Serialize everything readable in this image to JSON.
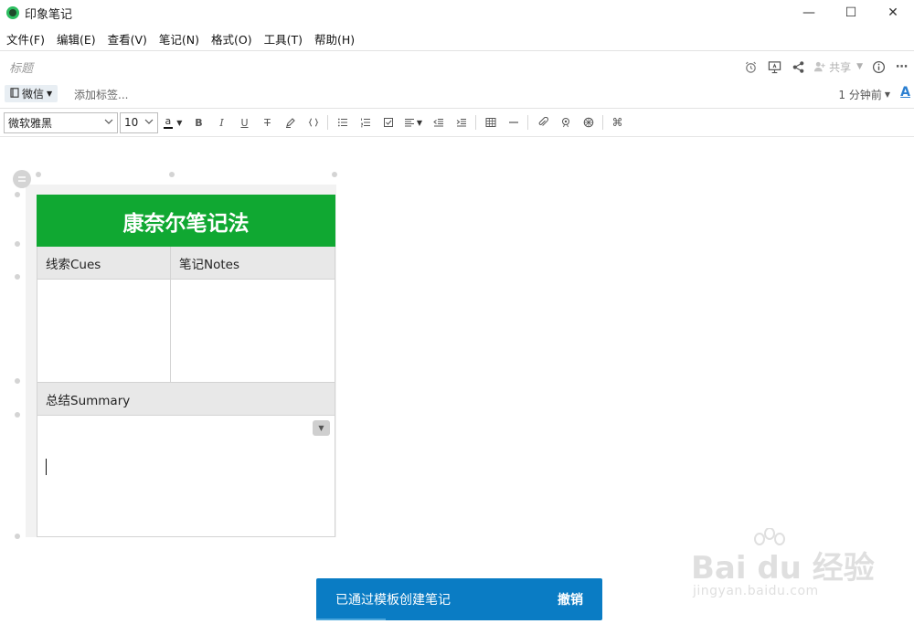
{
  "window": {
    "title": "印象笔记",
    "controls": {
      "minimize": "—",
      "maximize": "☐",
      "close": "✕"
    }
  },
  "menu": [
    "文件(F)",
    "编辑(E)",
    "查看(V)",
    "笔记(N)",
    "格式(O)",
    "工具(T)",
    "帮助(H)"
  ],
  "note": {
    "title_placeholder": "标题",
    "share_label": "共享",
    "notebook": "微信",
    "tag_placeholder": "添加标签...",
    "edit_time": "1 分钟前",
    "font_style_letter": "A"
  },
  "toolbar": {
    "font_family": "微软雅黑",
    "font_size": "10",
    "color_letter": "a",
    "bold": "B",
    "italic": "I",
    "underline": "U",
    "strike": "T"
  },
  "template": {
    "title": "康奈尔笔记法",
    "cues_label": "线索Cues",
    "notes_label": "笔记Notes",
    "summary_label": "总结Summary"
  },
  "toast": {
    "message": "已通过模板创建笔记",
    "undo": "撤销"
  },
  "watermark": {
    "brand": "Bai du 经验",
    "url": "jingyan.baidu.com"
  },
  "colors": {
    "template_header": "#10a832",
    "toast_bg": "#0a7cc4",
    "accent_blue": "#2b7fd1"
  }
}
